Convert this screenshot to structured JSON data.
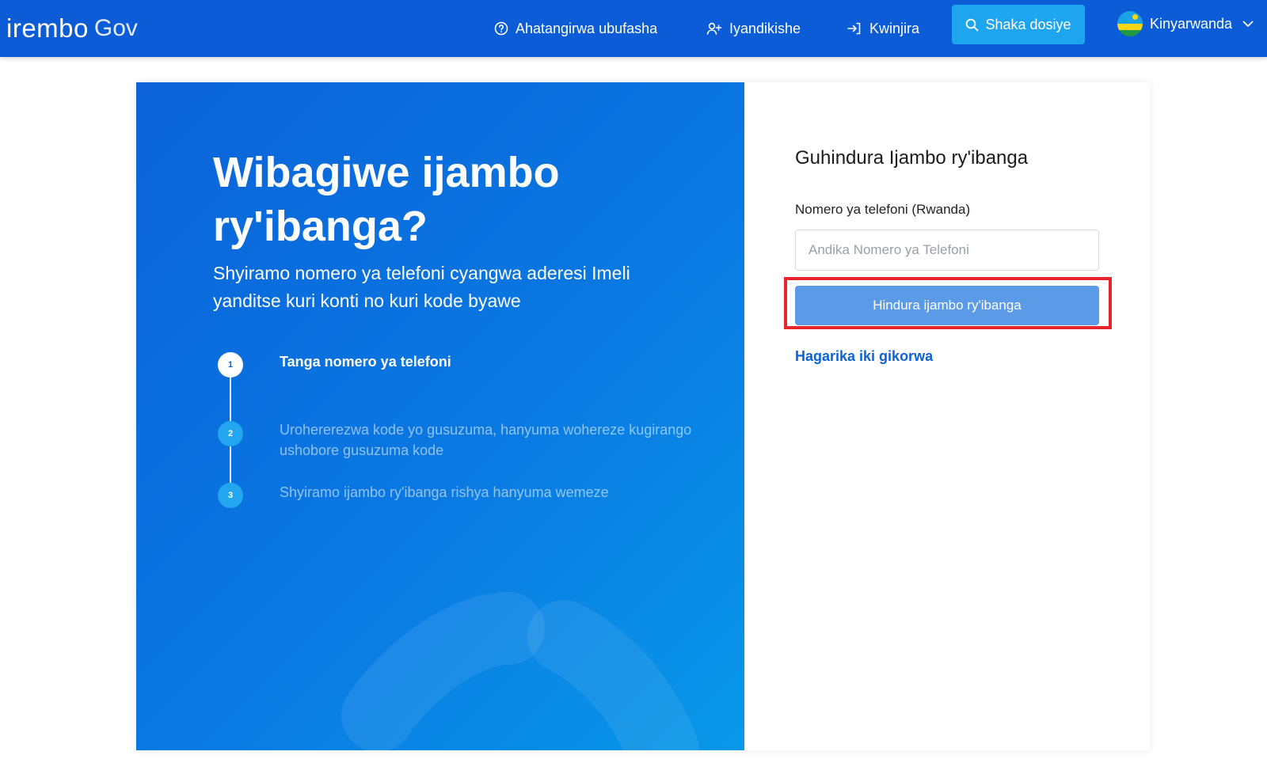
{
  "header": {
    "logo_main": "irembo",
    "logo_gov": "Gov",
    "nav": {
      "help": "Ahatangirwa ubufasha",
      "register": "Iyandikishe",
      "login": "Kwinjira"
    },
    "search_button": "Shaka dosiye",
    "language": "Kinyarwanda",
    "colors": {
      "bar": "#0b5cd6",
      "search": "#1ea5ef"
    }
  },
  "hero": {
    "title": "Wibagiwe ijambo ry'ibanga?",
    "subtitle": "Shyiramo nomero ya telefoni cyangwa aderesi Imeli yanditse kuri konti no kuri kode byawe",
    "steps": [
      {
        "number": "1",
        "text": "Tanga nomero ya telefoni"
      },
      {
        "number": "2",
        "text": "Urohererezwa kode yo gusuzuma, hanyuma wohereze kugirango ushobore gusuzuma kode"
      },
      {
        "number": "3",
        "text": "Shyiramo ijambo ry'ibanga rishya hanyuma wemeze"
      }
    ]
  },
  "form": {
    "title": "Guhindura Ijambo ry'ibanga",
    "phone_label": "Nomero ya telefoni (Rwanda)",
    "phone_value": "",
    "phone_placeholder": "Andika Nomero ya Telefoni",
    "submit_label": "Hindura ijambo ry'ibanga",
    "cancel_label": "Hagarika iki gikorwa",
    "colors": {
      "button": "#5a9ae6",
      "link": "#0b62d9",
      "highlight": "#e8242c"
    }
  }
}
